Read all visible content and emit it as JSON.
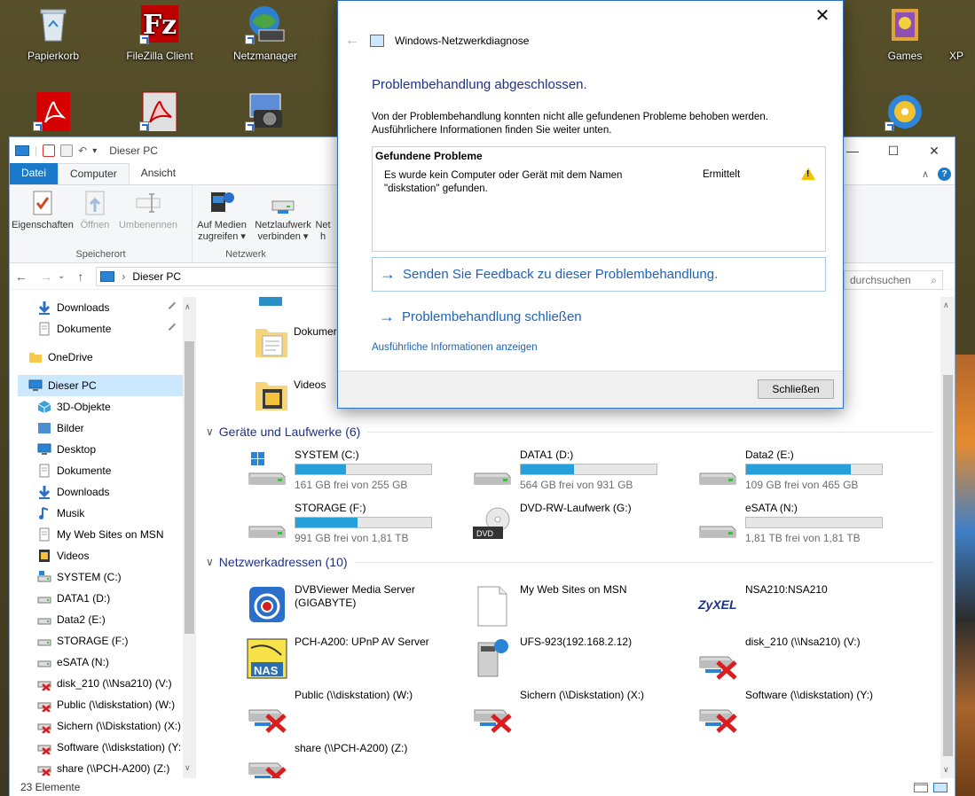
{
  "desktop": {
    "icons": [
      {
        "label": "Papierkorb",
        "icon": "recycle-bin-icon"
      },
      {
        "label": "FileZilla Client",
        "icon": "filezilla-icon"
      },
      {
        "label": "Netzmanager",
        "icon": "network-manager-icon"
      },
      {
        "label": "Games",
        "icon": "games-icon"
      },
      {
        "label": "XP",
        "icon": "xp-icon"
      }
    ]
  },
  "explorer": {
    "title": "Dieser PC",
    "tabs": [
      "Datei",
      "Computer",
      "Ansicht"
    ],
    "ribbon": {
      "groups": [
        {
          "label": "Speicherort",
          "buttons": [
            {
              "label": "Eigenschaften",
              "disabled": false
            },
            {
              "label": "Öffnen",
              "disabled": true
            },
            {
              "label": "Umbenennen",
              "disabled": true
            }
          ]
        },
        {
          "label": "Netzwerk",
          "buttons": [
            {
              "label": "Auf Medien zugreifen ▾",
              "disabled": false
            },
            {
              "label": "Netzlaufwerk verbinden ▾",
              "disabled": false
            },
            {
              "label": "Net h",
              "disabled": false
            }
          ]
        }
      ]
    },
    "address": "Dieser PC",
    "search_placeholder": "durchsuchen",
    "nav_items": [
      {
        "label": "Downloads",
        "icon": "download-arrow-icon",
        "pinned": true
      },
      {
        "label": "Dokumente",
        "icon": "document-icon",
        "pinned": true
      },
      {
        "label": "OneDrive",
        "icon": "folder-icon",
        "pinned": false
      },
      {
        "label": "Dieser PC",
        "icon": "computer-icon",
        "pinned": false,
        "selected": true
      },
      {
        "label": "3D-Objekte",
        "icon": "cube-icon"
      },
      {
        "label": "Bilder",
        "icon": "pictures-icon"
      },
      {
        "label": "Desktop",
        "icon": "desktop-icon"
      },
      {
        "label": "Dokumente",
        "icon": "document-icon"
      },
      {
        "label": "Downloads",
        "icon": "download-arrow-icon"
      },
      {
        "label": "Musik",
        "icon": "music-icon"
      },
      {
        "label": "My Web Sites on MSN",
        "icon": "page-icon"
      },
      {
        "label": "Videos",
        "icon": "video-icon"
      },
      {
        "label": "SYSTEM (C:)",
        "icon": "system-drive-icon"
      },
      {
        "label": "DATA1 (D:)",
        "icon": "drive-icon"
      },
      {
        "label": "Data2 (E:)",
        "icon": "drive-icon"
      },
      {
        "label": "STORAGE (F:)",
        "icon": "drive-icon"
      },
      {
        "label": "eSATA (N:)",
        "icon": "drive-icon"
      },
      {
        "label": "disk_210 (\\\\Nsa210) (V:)",
        "icon": "disconnected-drive-icon"
      },
      {
        "label": "Public (\\\\diskstation) (W:)",
        "icon": "disconnected-drive-icon"
      },
      {
        "label": "Sichern (\\\\Diskstation) (X:)",
        "icon": "disconnected-drive-icon"
      },
      {
        "label": "Software (\\\\diskstation) (Y:",
        "icon": "disconnected-drive-icon"
      },
      {
        "label": "share (\\\\PCH-A200) (Z:)",
        "icon": "disconnected-drive-icon"
      }
    ],
    "folders": [
      {
        "label": "Dokumer"
      },
      {
        "label": "Videos"
      }
    ],
    "sections": {
      "devices": "Geräte und Laufwerke (6)",
      "network": "Netzwerkadressen (10)"
    },
    "drives": [
      {
        "name": "SYSTEM (C:)",
        "free": "161 GB frei von 255 GB",
        "used_fraction": 0.37
      },
      {
        "name": "DATA1 (D:)",
        "free": "564 GB frei von 931 GB",
        "used_fraction": 0.39
      },
      {
        "name": "Data2 (E:)",
        "free": "109 GB frei von 465 GB",
        "used_fraction": 0.77
      },
      {
        "name": "STORAGE (F:)",
        "free": "991 GB frei von 1,81 TB",
        "used_fraction": 0.46
      },
      {
        "name": "DVD-RW-Laufwerk (G:)",
        "free": "",
        "used_fraction": null
      },
      {
        "name": "eSATA (N:)",
        "free": "1,81 TB frei von 1,81 TB",
        "used_fraction": 0.0
      }
    ],
    "network_locations": [
      {
        "name": "DVBViewer Media Server (GIGABYTE)",
        "icon": "media-server-icon"
      },
      {
        "name": "My Web Sites on MSN",
        "icon": "page-icon"
      },
      {
        "name": "NSA210:NSA210",
        "icon": "zyxel-icon"
      },
      {
        "name": "PCH-A200: UPnP AV Server",
        "icon": "nas-icon"
      },
      {
        "name": "UFS-923(192.168.2.12)",
        "icon": "media-box-icon"
      },
      {
        "name": "disk_210 (\\\\Nsa210) (V:)",
        "icon": "disconnected-drive-icon"
      },
      {
        "name": "Public (\\\\diskstation) (W:)",
        "icon": "disconnected-drive-icon"
      },
      {
        "name": "Sichern (\\\\Diskstation) (X:)",
        "icon": "disconnected-drive-icon"
      },
      {
        "name": "Software (\\\\diskstation) (Y:)",
        "icon": "disconnected-drive-icon"
      },
      {
        "name": "share (\\\\PCH-A200) (Z:)",
        "icon": "disconnected-drive-icon"
      }
    ],
    "zyxel_logo": "ZyXEL",
    "nas_badge": "NAS",
    "dvd_badge": "DVD",
    "status": "23 Elemente"
  },
  "dialog": {
    "title": "Windows-Netzwerkdiagnose",
    "heading": "Problembehandlung abgeschlossen.",
    "description": "Von der Problembehandlung konnten nicht alle gefundenen Probleme behoben werden. Ausführlichere Informationen finden Sie weiter unten.",
    "problems_header": "Gefundene Probleme",
    "problem_text": "Es wurde kein Computer oder Gerät mit dem Namen \"diskstation\" gefunden.",
    "problem_status": "Ermittelt",
    "feedback_link": "Senden Sie Feedback zu dieser Problembehandlung.",
    "close_link": "Problembehandlung schließen",
    "details_link": "Ausführliche Informationen anzeigen",
    "close_button": "Schließen"
  },
  "colors": {
    "accent": "#1979ca",
    "link": "#1f63b6",
    "heading": "#1e3287",
    "progress": "#26a0da",
    "selection": "#cce8ff",
    "error": "#d81e1e",
    "warning": "#f5c400"
  }
}
